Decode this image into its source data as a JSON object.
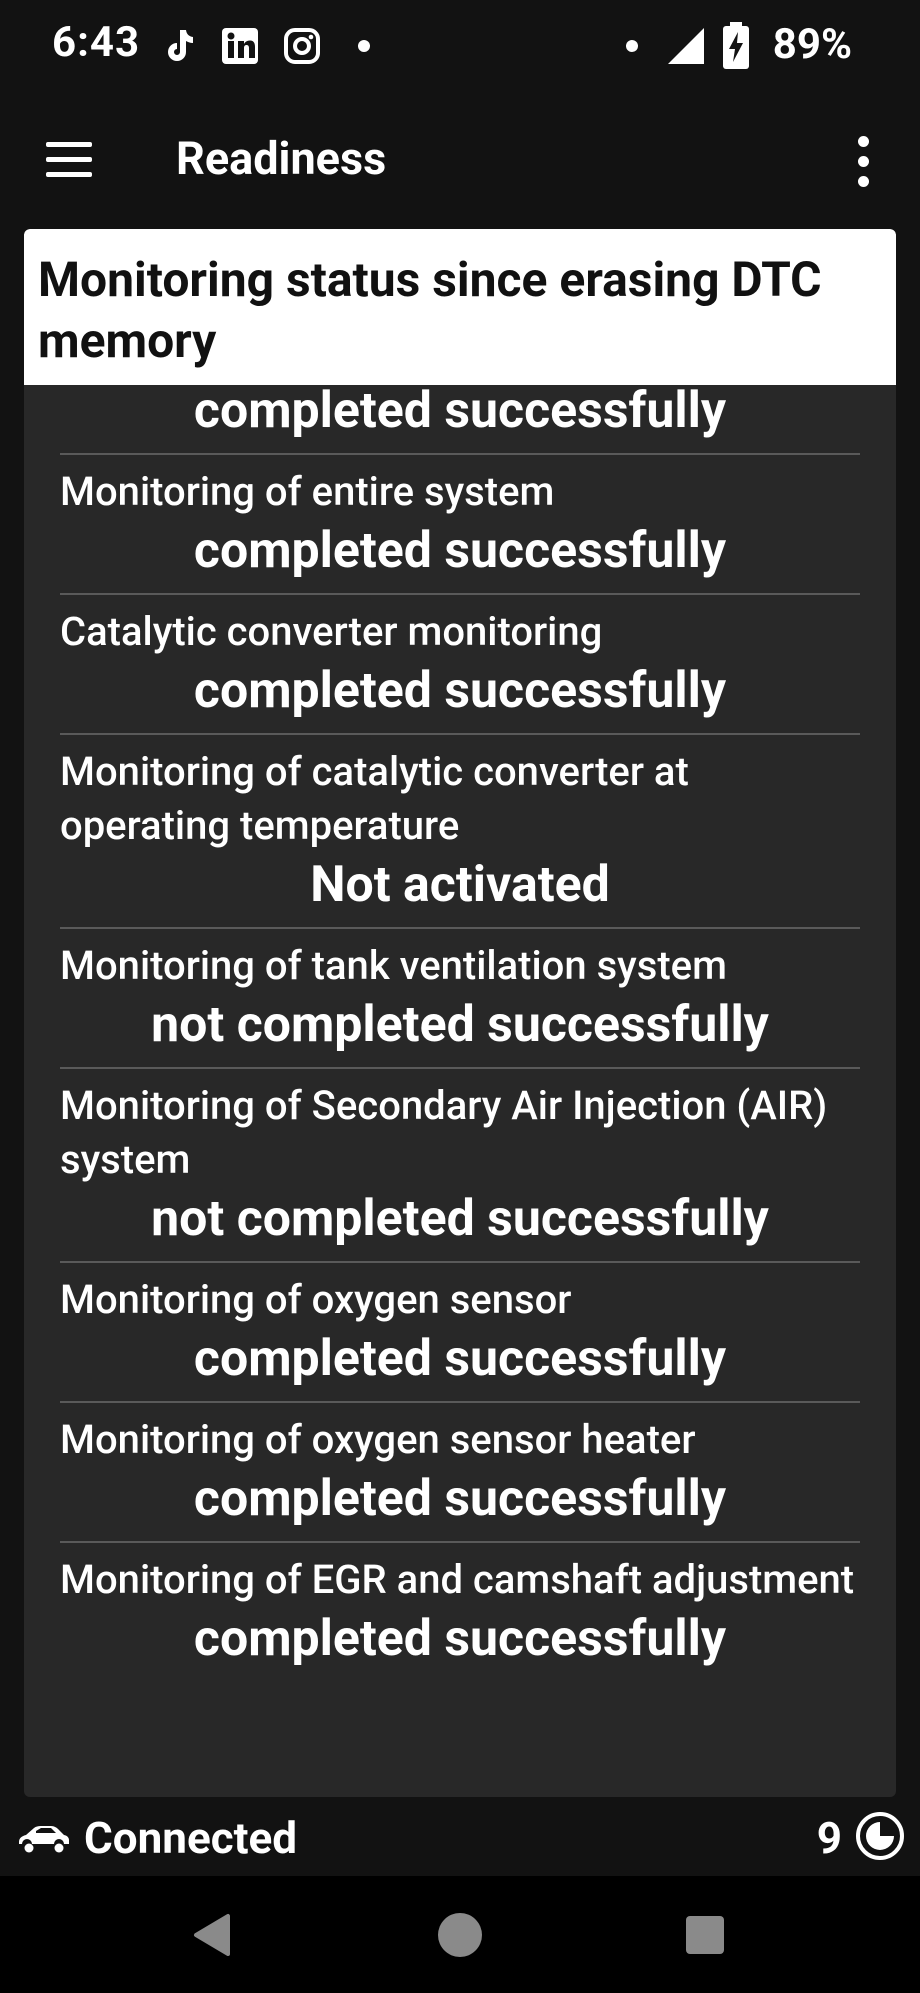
{
  "status_bar": {
    "time": "6:43",
    "battery": "89%",
    "icons": [
      "tiktok-icon",
      "linkedin-icon",
      "instagram-icon",
      "notification-dot-icon",
      "signal-icon",
      "battery-charging-icon"
    ]
  },
  "app_bar": {
    "title": "Readiness",
    "menu_icon": "hamburger-menu-icon",
    "overflow_icon": "more-vertical-icon"
  },
  "card": {
    "header": "Monitoring status since erasing DTC memory",
    "rows": [
      {
        "label": "",
        "value": "completed successfully"
      },
      {
        "label": "Monitoring of entire system",
        "value": "completed successfully"
      },
      {
        "label": "Catalytic converter monitoring",
        "value": "completed successfully"
      },
      {
        "label": "Monitoring of catalytic converter at operating temperature",
        "value": "Not activated"
      },
      {
        "label": "Monitoring of tank ventilation system",
        "value": "not completed successfully"
      },
      {
        "label": "Monitoring of Secondary Air Injection (AIR) system",
        "value": "not completed successfully"
      },
      {
        "label": "Monitoring of oxygen sensor",
        "value": "completed successfully"
      },
      {
        "label": "Monitoring of oxygen sensor heater",
        "value": "completed successfully"
      },
      {
        "label": "Monitoring of EGR and camshaft adjustment",
        "value": "completed successfully"
      }
    ]
  },
  "bottom_status": {
    "connection": "Connected",
    "count": "9",
    "car_icon": "car-icon",
    "refresh_icon": "refresh-icon"
  },
  "nav_bar": {
    "buttons": [
      "back-icon",
      "home-icon",
      "recents-icon"
    ]
  },
  "colors": {
    "background": "#121212",
    "card": "#282828",
    "header": "#ffffff",
    "divider": "#5a5a5a"
  }
}
